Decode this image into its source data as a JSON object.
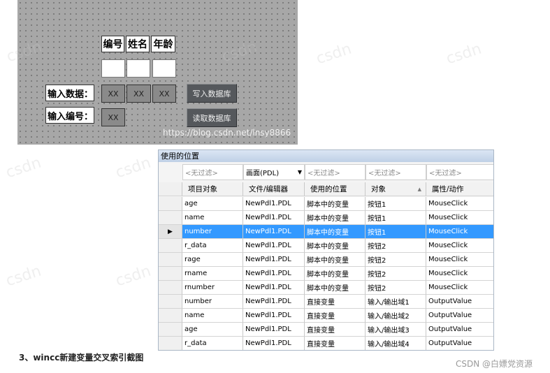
{
  "runtime": {
    "headers": [
      "编号",
      "姓名",
      "年龄"
    ],
    "input_data_label": "输入数据：",
    "input_id_label": "输入编号：",
    "io_values": [
      "XX",
      "XX",
      "XX"
    ],
    "id_io_value": "XX",
    "write_button": "写入数据库",
    "read_button": "读取数据库",
    "url_watermark": "https://blog.csdn.net/lnsy8866",
    "watermark": "csdn"
  },
  "xref": {
    "title": "使用的位置",
    "filters": [
      "<无过滤>",
      "画面(PDL)",
      "<无过滤>",
      "<无过滤>",
      "<无过滤>"
    ],
    "columns": [
      "项目对象",
      "文件/编辑器",
      "使用的位置",
      "对象",
      "属性/动作"
    ],
    "selected_row_marker": "▶",
    "rows": [
      [
        "age",
        "NewPdl1.PDL",
        "脚本中的变量",
        "按钮1",
        "MouseClick"
      ],
      [
        "name",
        "NewPdl1.PDL",
        "脚本中的变量",
        "按钮1",
        "MouseClick"
      ],
      [
        "number",
        "NewPdl1.PDL",
        "脚本中的变量",
        "按钮1",
        "MouseClick"
      ],
      [
        "r_data",
        "NewPdl1.PDL",
        "脚本中的变量",
        "按钮2",
        "MouseClick"
      ],
      [
        "rage",
        "NewPdl1.PDL",
        "脚本中的变量",
        "按钮2",
        "MouseClick"
      ],
      [
        "rname",
        "NewPdl1.PDL",
        "脚本中的变量",
        "按钮2",
        "MouseClick"
      ],
      [
        "rnumber",
        "NewPdl1.PDL",
        "脚本中的变量",
        "按钮2",
        "MouseClick"
      ],
      [
        "number",
        "NewPdl1.PDL",
        "直接变量",
        "输入/输出域1",
        "OutputValue"
      ],
      [
        "name",
        "NewPdl1.PDL",
        "直接变量",
        "输入/输出域2",
        "OutputValue"
      ],
      [
        "age",
        "NewPdl1.PDL",
        "直接变量",
        "输入/输出域3",
        "OutputValue"
      ],
      [
        "r_data",
        "NewPdl1.PDL",
        "直接变量",
        "输入/输出域4",
        "OutputValue"
      ]
    ]
  },
  "caption": "3、wincc新建变量交叉索引截图",
  "credit": "CSDN @白嫖党资源"
}
